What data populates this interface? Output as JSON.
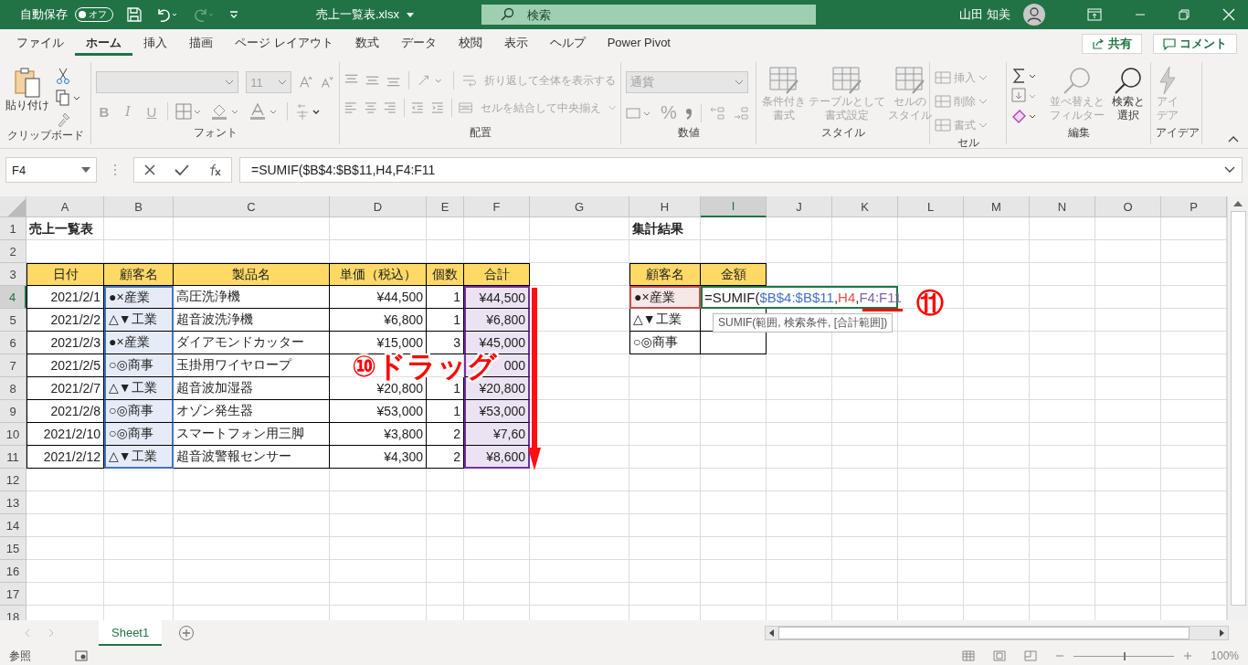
{
  "title_bar": {
    "autosave_label": "自動保存",
    "autosave": {
      "on": false,
      "label": "オフ"
    },
    "file_name": "売上一覧表.xlsx",
    "search": {
      "placeholder": "検索"
    },
    "user": "山田 知美"
  },
  "ribbon_tabs": [
    {
      "label": "ファイル",
      "selected": false
    },
    {
      "label": "ホーム",
      "selected": true
    },
    {
      "label": "挿入",
      "selected": false
    },
    {
      "label": "描画",
      "selected": false
    },
    {
      "label": "ページ レイアウト",
      "selected": false
    },
    {
      "label": "数式",
      "selected": false
    },
    {
      "label": "データ",
      "selected": false
    },
    {
      "label": "校閲",
      "selected": false
    },
    {
      "label": "表示",
      "selected": false
    },
    {
      "label": "ヘルプ",
      "selected": false
    },
    {
      "label": "Power Pivot",
      "selected": false
    }
  ],
  "share": "共有",
  "comment": "コメント",
  "ribbon": {
    "clipboard": {
      "label": "クリップボード",
      "paste": "貼り付け"
    },
    "font": {
      "label": "フォント",
      "font_size": "11",
      "bold": "B",
      "italic": "I",
      "underline": "U",
      "disabled": true
    },
    "alignment": {
      "label": "配置",
      "wrap_text": "折り返して全体を表示する",
      "merge": "セルを結合して中央揃え",
      "disabled": true
    },
    "number": {
      "label": "数値",
      "format": "通貨",
      "percent": "%",
      "disabled": true
    },
    "styles": {
      "label": "スタイル",
      "buttons": [
        {
          "lines": [
            "条件付き",
            "書式"
          ],
          "disabled": true
        },
        {
          "lines": [
            "テーブルとして",
            "書式設定"
          ],
          "disabled": true
        },
        {
          "lines": [
            "セルの",
            "スタイル"
          ],
          "disabled": true
        }
      ]
    },
    "cells": {
      "label": "セル",
      "buttons": [
        {
          "label": "挿入",
          "disabled": true
        },
        {
          "label": "削除",
          "disabled": true
        },
        {
          "label": "書式",
          "disabled": true
        }
      ]
    },
    "editing": {
      "label": "編集",
      "buttons": [
        {
          "lines": [
            "並べ替えと",
            "フィルター"
          ],
          "disabled": true
        },
        {
          "lines": [
            "検索と",
            "選択"
          ],
          "disabled": false
        }
      ]
    },
    "ideas": {
      "label": "アイデア",
      "button": {
        "lines": [
          "アイ",
          "デア"
        ],
        "disabled": true
      }
    }
  },
  "formula_bar": {
    "name_box": "F4",
    "formula": "=SUMIF($B$4:$B$11,H4,F4:F11"
  },
  "sheet": {
    "title": "売上一覧表",
    "columns": [
      {
        "label": "A",
        "selected": false
      },
      {
        "label": "B",
        "selected": false
      },
      {
        "label": "C",
        "selected": false
      },
      {
        "label": "D",
        "selected": false
      },
      {
        "label": "E",
        "selected": false
      },
      {
        "label": "F",
        "selected": false
      },
      {
        "label": "G",
        "selected": false
      },
      {
        "label": "H",
        "selected": false
      },
      {
        "label": "I",
        "selected": true
      },
      {
        "label": "J",
        "selected": false
      },
      {
        "label": "K",
        "selected": false
      },
      {
        "label": "L",
        "selected": false
      },
      {
        "label": "M",
        "selected": false
      },
      {
        "label": "N",
        "selected": false
      },
      {
        "label": "O",
        "selected": false
      },
      {
        "label": "P",
        "selected": false
      }
    ],
    "rows": [
      {
        "label": "1",
        "selected": false
      },
      {
        "label": "2",
        "selected": false
      },
      {
        "label": "3",
        "selected": false
      },
      {
        "label": "4",
        "selected": true
      },
      {
        "label": "5",
        "selected": false
      },
      {
        "label": "6",
        "selected": false
      },
      {
        "label": "7",
        "selected": false
      },
      {
        "label": "8",
        "selected": false
      },
      {
        "label": "9",
        "selected": false
      },
      {
        "label": "10",
        "selected": false
      },
      {
        "label": "11",
        "selected": false
      },
      {
        "label": "12",
        "selected": false
      },
      {
        "label": "13",
        "selected": false
      },
      {
        "label": "14",
        "selected": false
      },
      {
        "label": "15",
        "selected": false
      },
      {
        "label": "16",
        "selected": false
      },
      {
        "label": "17",
        "selected": false
      },
      {
        "label": "18",
        "selected": false
      }
    ]
  },
  "sales_table": {
    "columns": [
      {
        "label": "日付",
        "highlighted": false
      },
      {
        "label": "顧客名",
        "highlighted": true,
        "color": "#4472c4"
      },
      {
        "label": "製品名",
        "highlighted": false
      },
      {
        "label": "単価（税込）",
        "highlighted": false
      },
      {
        "label": "個数",
        "highlighted": false
      },
      {
        "label": "合計",
        "highlighted": true,
        "color": "#7030a0"
      }
    ],
    "rows": [
      {
        "date": "2021/2/1",
        "customer": "●×産業",
        "product": "高圧洗浄機",
        "price": "¥44,500",
        "quantity": "1",
        "total": "¥44,500"
      },
      {
        "date": "2021/2/2",
        "customer": "△▼工業",
        "product": "超音波洗浄機",
        "price": "¥6,800",
        "quantity": "1",
        "total": "¥6,800"
      },
      {
        "date": "2021/2/3",
        "customer": "●×産業",
        "product": "ダイアモンドカッター",
        "price": "¥15,000",
        "quantity": "3",
        "total": "¥45,000"
      },
      {
        "date": "2021/2/5",
        "customer": "○◎商事",
        "product": "玉掛用ワイヤロープ",
        "total": "000"
      },
      {
        "date": "2021/2/7",
        "customer": "△▼工業",
        "product": "超音波加湿器",
        "price": "¥20,800",
        "quantity": "1",
        "total": "¥20,800"
      },
      {
        "date": "2021/2/8",
        "customer": "○◎商事",
        "product": "オゾン発生器",
        "price": "¥53,000",
        "quantity": "1",
        "total": "¥53,000"
      },
      {
        "date": "2021/2/10",
        "customer": "○◎商事",
        "product": "スマートフォン用三脚",
        "price": "¥3,800",
        "quantity": "2",
        "total": "¥7,60"
      },
      {
        "date": "2021/2/12",
        "customer": "△▼工業",
        "product": "超音波警報センサー",
        "price": "¥4,300",
        "quantity": "2",
        "total": "¥8,600"
      }
    ]
  },
  "summary": {
    "title": "集計結果",
    "columns": [
      "顧客名",
      "金額"
    ],
    "rows": [
      {
        "customer": "●×産業",
        "highlighted": true,
        "color": "#c0504d",
        "amount_parts": [
          {
            "text": "=SUMIF("
          },
          {
            "text": "$B$4:$B$11",
            "color": "#4472c4"
          },
          {
            "text": ","
          },
          {
            "text": "H4",
            "color": "#e0504d"
          },
          {
            "text": ","
          },
          {
            "text": "F4:F11",
            "color": "#8064a2"
          }
        ]
      },
      {
        "customer": "△▼工業",
        "highlighted": false
      },
      {
        "customer": "○◎商事",
        "highlighted": false
      }
    ]
  },
  "tooltip": "SUMIF(範囲, 検索条件, [合計範囲])",
  "annotations": {
    "drag_label": "⑩ドラッグ",
    "step_mark": "⑪"
  },
  "sheet_tabs": [
    {
      "label": "Sheet1",
      "selected": true
    }
  ],
  "status_bar": {
    "mode": "参照",
    "zoom": "100%",
    "zoom_slider": {
      "level": 0.5
    }
  }
}
